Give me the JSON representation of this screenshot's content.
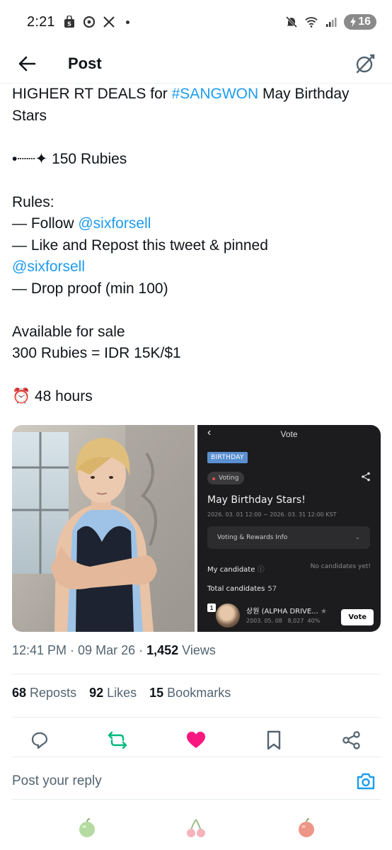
{
  "status_bar": {
    "time": "2:21",
    "left_icons": [
      "shop-icon",
      "location-target-icon",
      "x-logo-icon"
    ],
    "right_icons": [
      "mute-icon",
      "wifi-icon",
      "signal-icon"
    ],
    "battery": "16"
  },
  "header": {
    "title": "Post",
    "back_icon": "arrow-left-icon",
    "grok_icon": "grok-icon"
  },
  "post": {
    "line1_prefix": "HIGHER RT DEALS for ",
    "hashtag": "#SANGWON",
    "line1_suffix": " May Birthday Stars",
    "rubies_bullet": "•┈┈✦",
    "rubies_line": " 150 Rubies",
    "rules_title": "Rules:",
    "rule1_prefix": "— Follow ",
    "mention": "@sixforsell",
    "rule2_text": "— Like and Repost this tweet & pinned",
    "rule2_mention": "@sixforsell",
    "rule3_text": "— Drop proof (min 100)",
    "sale_title": "Available for sale",
    "sale_price": "300 Rubies = IDR 15K/$1",
    "timer_emoji": "⏰",
    "timer_text": " 48 hours"
  },
  "media_app": {
    "topbar_title": "Vote",
    "badge": "BIRTHDAY",
    "status_pill": "Voting",
    "title": "May Birthday Stars!",
    "dates": "2026. 03. 01 12:00 ~ 2026. 03. 31 12:00 KST",
    "info_label": "Voting & Rewards Info",
    "my_candidate_label": "My candidate",
    "no_candidates": "No candidates yet!",
    "total_candidates_label": "Total candidates",
    "total_candidates_count": "57",
    "candidate": {
      "rank": "1",
      "name": "상원 (ALPHA DRIVE...",
      "birth": "2003. 05. 08",
      "votes": "8,027",
      "percent": "40%",
      "vote_button": "Vote"
    }
  },
  "meta": {
    "time": "12:41 PM",
    "date": "09 Mar 26",
    "views_count": "1,452",
    "views_label": "Views"
  },
  "stats": {
    "reposts_count": "68",
    "reposts_label": "Reposts",
    "likes_count": "92",
    "likes_label": "Likes",
    "bookmarks_count": "15",
    "bookmarks_label": "Bookmarks"
  },
  "actions": [
    "reply-icon",
    "repost-icon",
    "like-icon",
    "bookmark-icon",
    "share-icon"
  ],
  "colors": {
    "link": "#1d9bf0",
    "repost_active": "#00ba7c",
    "like_active": "#f91880",
    "muted": "#536471"
  },
  "reply": {
    "placeholder": "Post your reply"
  },
  "dock": [
    "green-apple-icon",
    "cherries-icon",
    "red-apple-icon"
  ]
}
